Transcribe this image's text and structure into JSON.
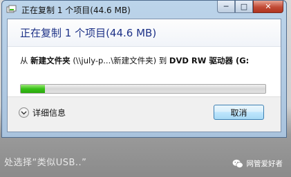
{
  "window": {
    "title": "正在复制 1 个项目(44.6 MB)",
    "buttons": {
      "minimize": "─",
      "maximize": "□",
      "close": "✕"
    }
  },
  "dialog": {
    "header": "正在复制 1 个项目(44.6 MB)",
    "from_prefix": "从",
    "from_folder": "新建文件夹",
    "from_path": "(\\\\july-p...\\新建文件夹)",
    "to_prefix": "到",
    "to_target": "DVD RW 驱动器 (G:",
    "progress_fraction": 0.1,
    "details_label": "详细信息",
    "cancel_label": "取消"
  },
  "background": {
    "caption": "处选择“类似USB..”"
  },
  "watermark": {
    "text": "网管爱好者"
  },
  "colors": {
    "header_text": "#1e3287",
    "progress_green": "#37c117",
    "title_bar": "#bcd4ea"
  }
}
